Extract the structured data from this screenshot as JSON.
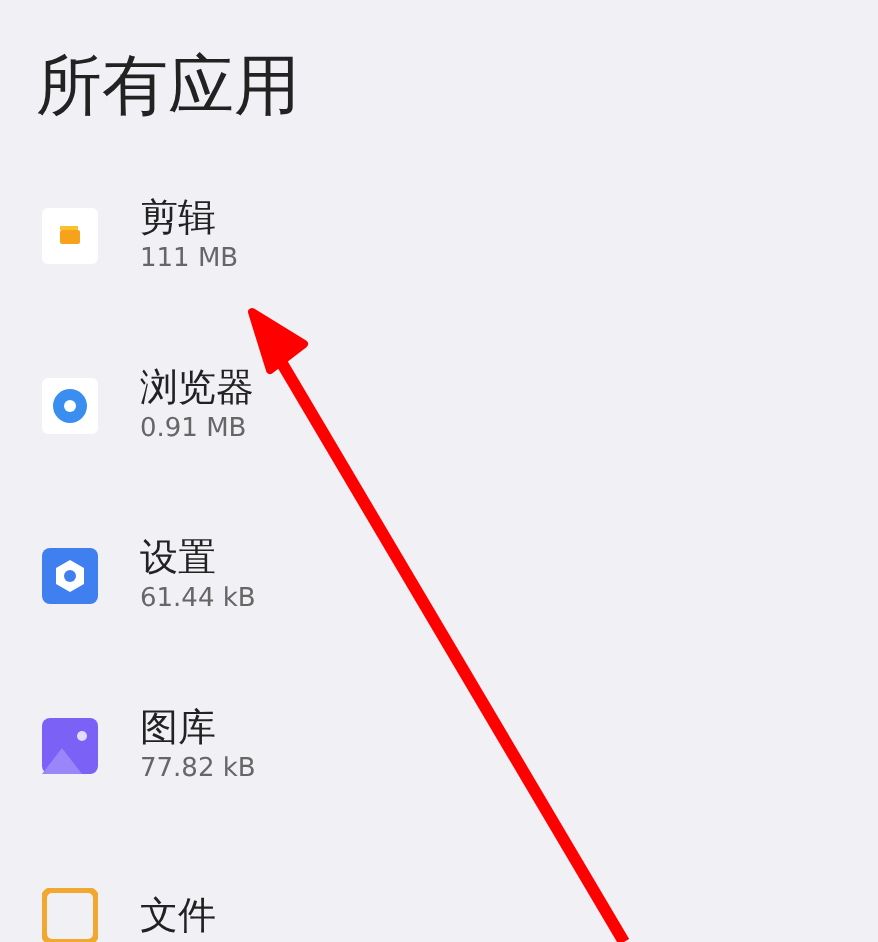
{
  "title": "所有应用",
  "apps": [
    {
      "kind": "clip",
      "name": "剪辑",
      "size": "111 MB"
    },
    {
      "kind": "browser",
      "name": "浏览器",
      "size": "0.91 MB"
    },
    {
      "kind": "settings",
      "name": "设置",
      "size": "61.44 kB"
    },
    {
      "kind": "gallery",
      "name": "图库",
      "size": "77.82 kB"
    },
    {
      "kind": "files",
      "name": "文件"
    }
  ]
}
